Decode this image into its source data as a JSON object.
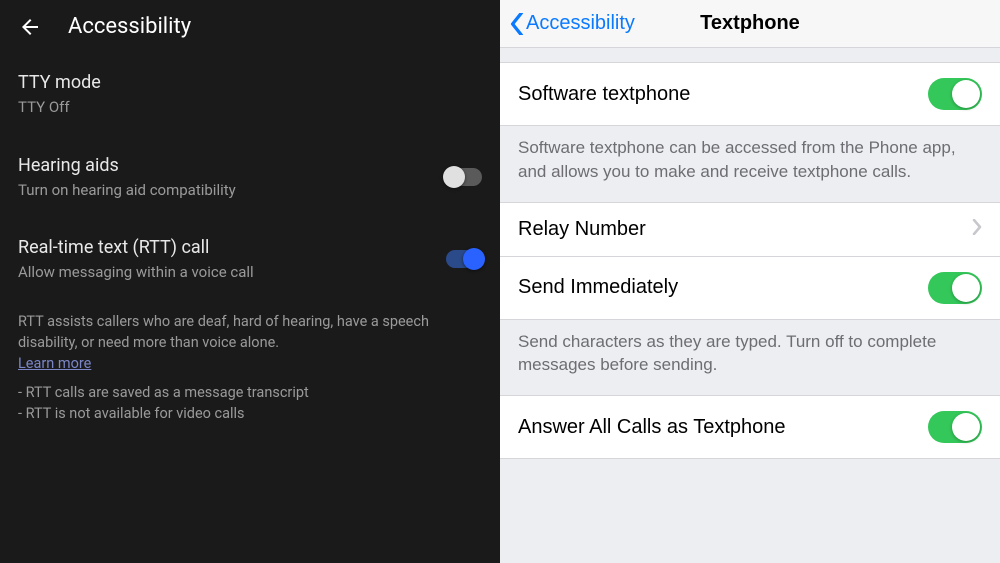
{
  "android": {
    "header_title": "Accessibility",
    "items": [
      {
        "title": "TTY mode",
        "subtitle": "TTY Off"
      },
      {
        "title": "Hearing aids",
        "subtitle": "Turn on hearing aid compatibility"
      },
      {
        "title": "Real-time text (RTT) call",
        "subtitle": "Allow messaging within a voice call"
      }
    ],
    "footer": {
      "desc": "RTT assists callers who are deaf, hard of hearing, have a speech disability, or need more than voice alone.",
      "learn_more": "Learn more",
      "bullet1": "- RTT calls are saved as a message transcript",
      "bullet2": "- RTT is not available for video calls"
    }
  },
  "ios": {
    "back_label": "Accessibility",
    "title": "Textphone",
    "rows": {
      "software": "Software textphone",
      "software_footer": "Software textphone can be accessed from the Phone app, and allows you to make and receive textphone calls.",
      "relay": "Relay Number",
      "send": "Send Immediately",
      "send_footer": "Send characters as they are typed. Turn off to complete messages before sending.",
      "answer": "Answer All Calls as Textphone"
    }
  }
}
